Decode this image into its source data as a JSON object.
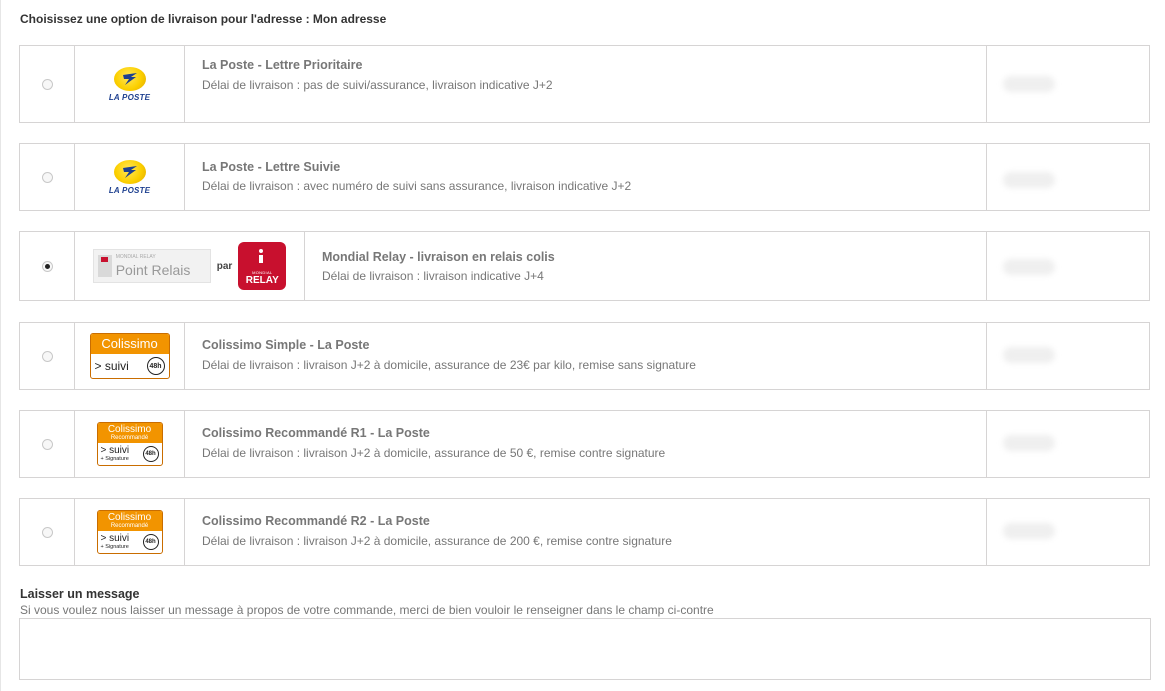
{
  "page": {
    "title": "Choisissez une option de livraison pour l'adresse : Mon adresse"
  },
  "options": [
    {
      "name": "La Poste - Lettre Prioritaire",
      "delay": "Délai de livraison : pas de suivi/assurance, livraison indicative J+2",
      "logo_text": "LA POSTE",
      "selected": false
    },
    {
      "name": "La Poste - Lettre Suivie",
      "delay": "Délai de livraison : avec numéro de suivi sans assurance, livraison indicative J+2",
      "logo_text": "LA POSTE",
      "selected": false
    },
    {
      "name": "Mondial Relay - livraison en relais colis",
      "delay": "Délai de livraison : livraison indicative J+4",
      "logo_small": "MONDIAL RELAY",
      "logo_text": "Point Relais",
      "logo_par": "par",
      "badge_small": "MONDIAL",
      "badge_text": "RELAY",
      "selected": true
    },
    {
      "name": "Colissimo Simple - La Poste",
      "delay": "Délai de livraison : livraison J+2 à domicile, assurance de 23€ par kilo, remise sans signature",
      "logo_top": "Colissimo",
      "logo_suivi": "> suivi",
      "logo_badge": "48h",
      "selected": false
    },
    {
      "name": "Colissimo Recommandé R1 - La Poste",
      "delay": "Délai de livraison : livraison J+2 à domicile, assurance de 50 €, remise contre signature",
      "logo_top": "Colissimo",
      "logo_sub": "Recommandé",
      "logo_suivi": "> suivi",
      "logo_sig": "+ Signature",
      "logo_badge": "48h",
      "selected": false
    },
    {
      "name": "Colissimo Recommandé R2 - La Poste",
      "delay": "Délai de livraison : livraison J+2 à domicile, assurance de 200 €, remise contre signature",
      "logo_top": "Colissimo",
      "logo_sub": "Recommandé",
      "logo_suivi": "> suivi",
      "logo_sig": "+ Signature",
      "logo_badge": "48h",
      "selected": false
    }
  ],
  "message": {
    "label": "Laisser un message",
    "help": "Si vous voulez nous laisser un message à propos de votre commande, merci de bien vouloir le renseigner dans le champ ci-contre",
    "value": ""
  },
  "colors": {
    "border": "#d6d4d4",
    "text": "#777777",
    "heading": "#333333",
    "colissimo_orange": "#f29400",
    "relay_red": "#c8102e",
    "laposte_yellow": "#fcd000",
    "laposte_blue": "#1d3f8f"
  },
  "icons": {
    "radio": "radio-button",
    "laposte": "la-poste-logo",
    "mondial_relay": "mondial-relay-logo",
    "colissimo": "colissimo-logo"
  }
}
